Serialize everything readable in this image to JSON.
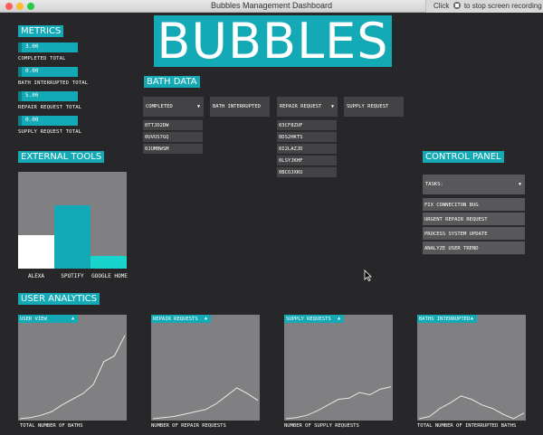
{
  "window": {
    "title": "Bubbles Management Dashboard",
    "recording_notice_prefix": "Click",
    "recording_notice_suffix": "to stop screen recording"
  },
  "logo": "BUBBLES",
  "metrics": {
    "title": "METRICS",
    "items": [
      {
        "value": "3.00",
        "label": "COMPLETED TOTAL"
      },
      {
        "value": "0.00",
        "label": "BATH INTERRUPTED TOTAL"
      },
      {
        "value": "5.00",
        "label": "REPAIR REQUEST TOTAL"
      },
      {
        "value": "0.00",
        "label": "SUPPLY REQUEST TOTAL"
      }
    ]
  },
  "bath_data": {
    "title": "BATH DATA",
    "dropdowns": [
      {
        "label": "COMPLETED",
        "items": [
          "0TTJD2DW",
          "0UVUS7GQ",
          "0JUMBWSM"
        ]
      },
      {
        "label": "BATH INTERRUPTED",
        "items": []
      },
      {
        "label": "REPAIR REQUEST",
        "items": [
          "03CF8ZUF",
          "0DS2HKTS",
          "0I2LAZJD",
          "0LSYJKHF",
          "0BCOJXKU"
        ]
      },
      {
        "label": "SUPPLY REQUEST",
        "items": []
      }
    ]
  },
  "external_tools": {
    "title": "EXTERNAL TOOLS",
    "bars": [
      {
        "label": "ALEXA",
        "value": 0.35,
        "color": "#ffffff"
      },
      {
        "label": "SPOTIFY",
        "value": 0.65,
        "color": "#13a9b5"
      },
      {
        "label": "GOOGLE HOME",
        "value": 0.13,
        "color": "#19d4cc"
      }
    ]
  },
  "control_panel": {
    "title": "CONTROL PANEL",
    "dropdown_label": "TASKS:",
    "items": [
      "FIX CONNECITON BUG",
      "URGENT REPAIR REQUEST",
      "PROCESS SYSTEM UPDATE",
      "ANALYZE USER TREND"
    ]
  },
  "user_analytics": {
    "title": "USER ANALYTICS",
    "charts": [
      {
        "tag": "USER VIEW",
        "caption": "TOTAL NUMBER OF BATHS",
        "values": [
          0,
          1,
          3,
          6,
          12,
          17,
          22,
          30,
          50,
          55,
          73
        ]
      },
      {
        "tag": "REPAIR REQUESTS",
        "caption": "NUMBER OF REPAIR REQUESTS",
        "values": [
          0,
          1,
          2,
          4,
          6,
          8,
          13,
          20,
          27,
          22,
          16
        ]
      },
      {
        "tag": "SUPPLY REQUESTS",
        "caption": "NUMBER OF SUPPLY REQUESTS",
        "values": [
          0,
          1,
          3,
          7,
          12,
          17,
          18,
          23,
          21,
          26,
          28
        ]
      },
      {
        "tag": "BATHS INTERRUPTED",
        "caption": "TOTAL NUMBER OF INTERRUPTED BATHS",
        "values": [
          0,
          2,
          9,
          14,
          20,
          17,
          12,
          9,
          4,
          0,
          5
        ]
      }
    ]
  },
  "colors": {
    "accent": "#13a9b5",
    "panel_bg": "#808082",
    "background": "#272729"
  }
}
